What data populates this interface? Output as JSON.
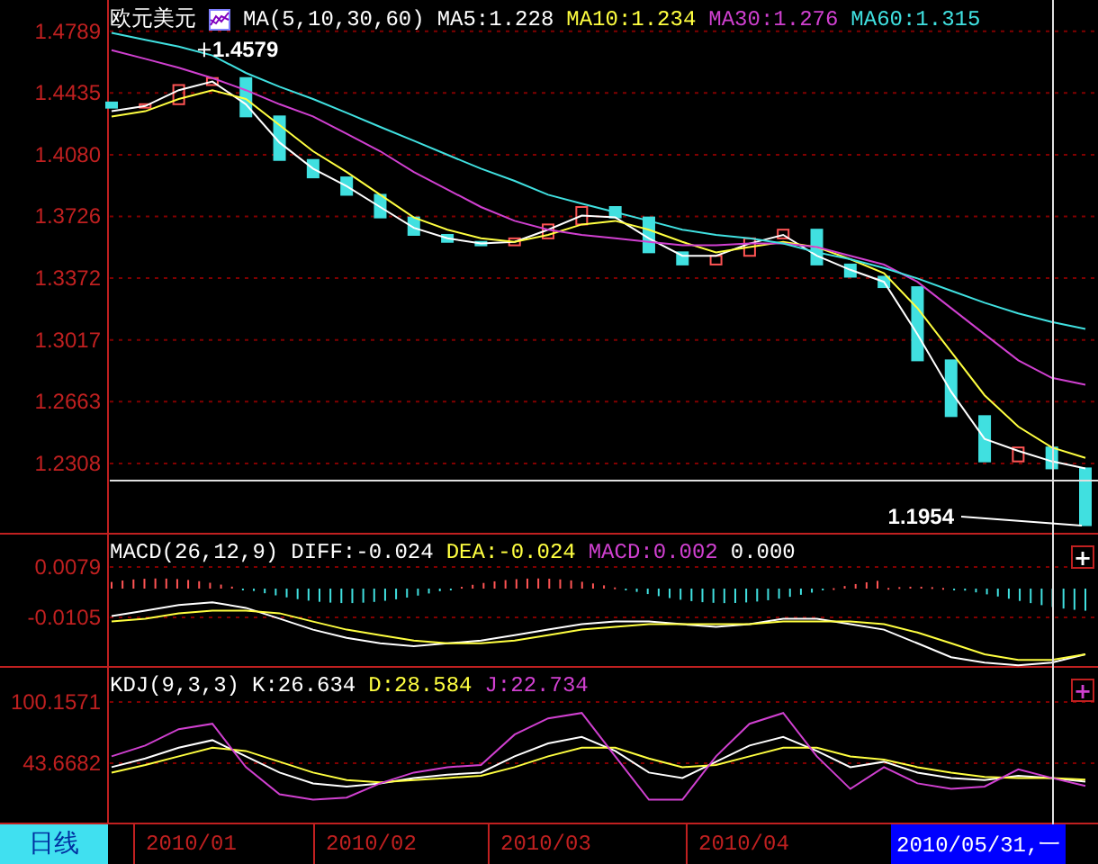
{
  "header": {
    "instrument": "欧元美元",
    "indicator": "MA(5,10,30,60)",
    "items": [
      {
        "text": "MA5:1.228",
        "color": "#ffffff"
      },
      {
        "text": "MA10:1.234",
        "color": "#ffff40"
      },
      {
        "text": "MA30:1.276",
        "color": "#d040d0"
      },
      {
        "text": "MA60:1.315",
        "color": "#40e0e0"
      }
    ]
  },
  "price_chart": {
    "axis_labels": [
      "1.4789",
      "1.4435",
      "1.4080",
      "1.3726",
      "1.3372",
      "1.3017",
      "1.2663",
      "1.2308"
    ],
    "high_label": "1.4579",
    "low_label": "1.1954"
  },
  "macd": {
    "title": "MACD(26,12,9)",
    "items": [
      {
        "text": "DIFF:-0.024",
        "color": "#ffffff"
      },
      {
        "text": "DEA:-0.024",
        "color": "#ffff40"
      },
      {
        "text": "MACD:0.002",
        "color": "#d040d0"
      },
      {
        "text": "0.000",
        "color": "#ffffff"
      }
    ],
    "expand_button": "+",
    "axis_labels": [
      "0.0079",
      "-0.0105"
    ]
  },
  "kdj": {
    "title": "KDJ(9,3,3)",
    "items": [
      {
        "text": "K:26.634",
        "color": "#ffffff"
      },
      {
        "text": "D:28.584",
        "color": "#ffff40"
      },
      {
        "text": "J:22.734",
        "color": "#d040d0"
      }
    ],
    "expand_button": "+",
    "axis_labels": [
      "100.1571",
      "43.6682"
    ]
  },
  "period_tab": {
    "label": "日线",
    "selected": true
  },
  "date_axis": [
    "2010/01",
    "2010/02",
    "2010/03",
    "2010/04"
  ],
  "cursor_date": "2010/05/31,一"
}
